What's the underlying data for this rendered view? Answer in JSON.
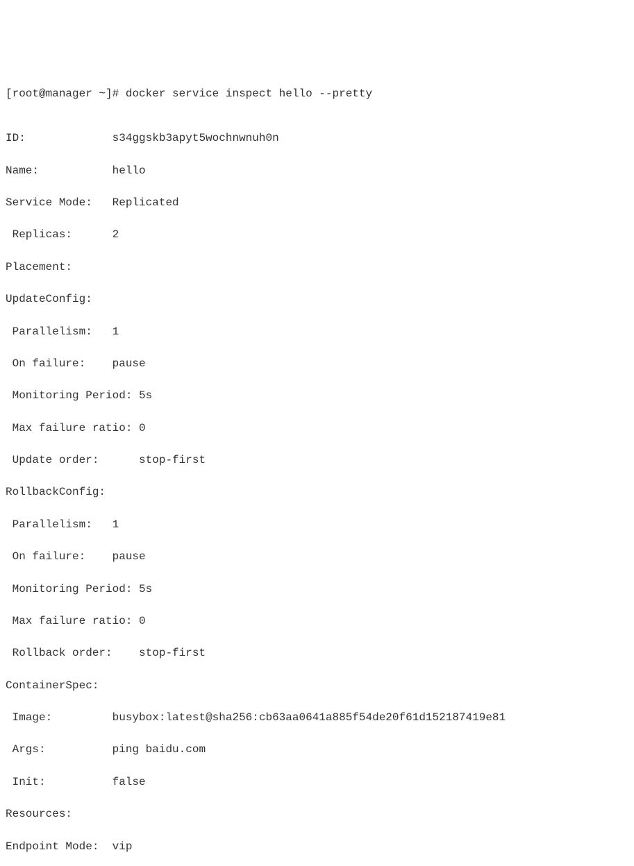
{
  "prompt": {
    "user_host": "[root@manager ~]#",
    "command": "docker service inspect hello --pretty"
  },
  "output": {
    "id_label": "ID:",
    "id_value": "s34ggskb3apyt5wochnwnuh0n",
    "name_label": "Name:",
    "name_value": "hello",
    "service_mode_label": "Service Mode:",
    "service_mode_value": "Replicated",
    "replicas_label": " Replicas:",
    "replicas_value": "2",
    "placement_label": "Placement:",
    "update_config_label": "UpdateConfig:",
    "uc_parallelism_label": " Parallelism:",
    "uc_parallelism_value": "1",
    "uc_onfailure_label": " On failure:",
    "uc_onfailure_value": "pause",
    "uc_monitoring_label": " Monitoring Period:",
    "uc_monitoring_value": "5s",
    "uc_maxfail_label": " Max failure ratio:",
    "uc_maxfail_value": "0",
    "uc_order_label": " Update order:",
    "uc_order_value": "stop-first",
    "rollback_config_label": "RollbackConfig:",
    "rc_parallelism_label": " Parallelism:",
    "rc_parallelism_value": "1",
    "rc_onfailure_label": " On failure:",
    "rc_onfailure_value": "pause",
    "rc_monitoring_label": " Monitoring Period:",
    "rc_monitoring_value": "5s",
    "rc_maxfail_label": " Max failure ratio:",
    "rc_maxfail_value": "0",
    "rc_order_label": " Rollback order:",
    "rc_order_value": "stop-first",
    "container_spec_label": "ContainerSpec:",
    "cs_image_label": " Image:",
    "cs_image_value": "busybox:latest@sha256:cb63aa0641a885f54de20f61d152187419e81",
    "cs_args_label": " Args:",
    "cs_args_value": "ping baidu.com",
    "cs_init_label": " Init:",
    "cs_init_value": "false",
    "resources_label": "Resources:",
    "endpoint_mode_label": "Endpoint Mode:",
    "endpoint_mode_value": "vip"
  }
}
